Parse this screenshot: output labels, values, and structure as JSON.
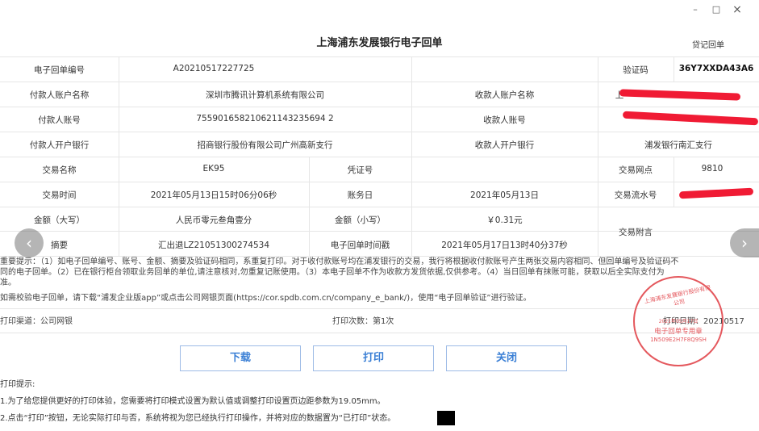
{
  "window": {
    "minimize": "–",
    "maximize": "□",
    "close": "×"
  },
  "receipt": {
    "title": "上海浦东发展银行电子回单",
    "type": "贷记回单",
    "rows": {
      "r1": {
        "l1": "电子回单编号",
        "v1": "A20210517227725",
        "l3": "验证码",
        "v3": "36Y7XXDA43A6"
      },
      "r2": {
        "l1": "付款人账户名称",
        "v1": "深圳市腾讯计算机系统有限公司",
        "l2": "收款人账户名称",
        "v2": "上"
      },
      "r3": {
        "l1": "付款人账号",
        "v1": "755901658210621143235694 2",
        "l2": "收款人账号"
      },
      "r4": {
        "l1": "付款人开户银行",
        "v1": "招商银行股份有限公司广州高新支行",
        "l2": "收款人开户银行",
        "v2": "浦发银行南汇支行"
      },
      "r5": {
        "l1": "交易名称",
        "v1": "EK95",
        "l2": "凭证号",
        "l3": "交易网点",
        "v3": "9810"
      },
      "r6": {
        "l1": "交易时间",
        "v1": "2021年05月13日15时06分06秒",
        "l2": "账务日",
        "v2": "2021年05月13日",
        "l3": "交易流水号"
      },
      "r7": {
        "l1": "金额（大写）",
        "v1": "人民币零元叁角壹分",
        "l2": "金额（小写）",
        "v2": "￥0.31元",
        "l3": "交易附言"
      },
      "r8": {
        "l1": "摘要",
        "v1": "汇出退LZ21051300274534",
        "l2": "电子回单时间戳",
        "v2": "2021年05月17日13时40分37秒"
      }
    },
    "notice_lines": [
      "重要提示：（1）如电子回单编号、账号、金额、摘要及验证码相同，系重复打印。对于收付款账号均在浦发银行的交易，我行将根据收付款账号产生两张交易内容相同、但回单编号及验证码不",
      "同的电子回单。（2）已在银行柜台领取业务回单的单位,请注意核对,勿重复记账使用。（3）本电子回单不作为收款方发货依据,仅供参考。（4）当日回单有抹账可能，获取以后全实际支付为",
      "准。"
    ],
    "verify_note": "如需校验电子回单，请下载“浦发企业版app”或点击公司网银页面(https://cor.spdb.com.cn/company_e_bank/)，使用“电子回单验证”进行验证。",
    "print_channel": "打印渠道：公司网银",
    "print_count": "打印次数：第1次",
    "print_date": "打印日期：20210517"
  },
  "seal": {
    "arc_text": "上海浦东发展银行股份有限公司",
    "date": "2021年05月17日",
    "label": "电子回单专用章",
    "code": "1N509E2H7F8Q9SH"
  },
  "buttons": {
    "download": "下载",
    "print": "打印",
    "close": "关闭"
  },
  "tips": {
    "heading": "打印提示:",
    "line1": "1.为了给您提供更好的打印体验，您需要将打印模式设置为默认值或调整打印设置页边距参数为19.05mm。",
    "line2": "2.点击“打印”按钮，无论实际打印与否，系统将视为您已经执行打印操作，并将对应的数据置为“已打印”状态。"
  },
  "nav": {
    "prev": "‹",
    "next": "›"
  },
  "colors": {
    "accent": "#3a7fd5",
    "seal": "#e2464c",
    "redaction": "#f01b34"
  }
}
